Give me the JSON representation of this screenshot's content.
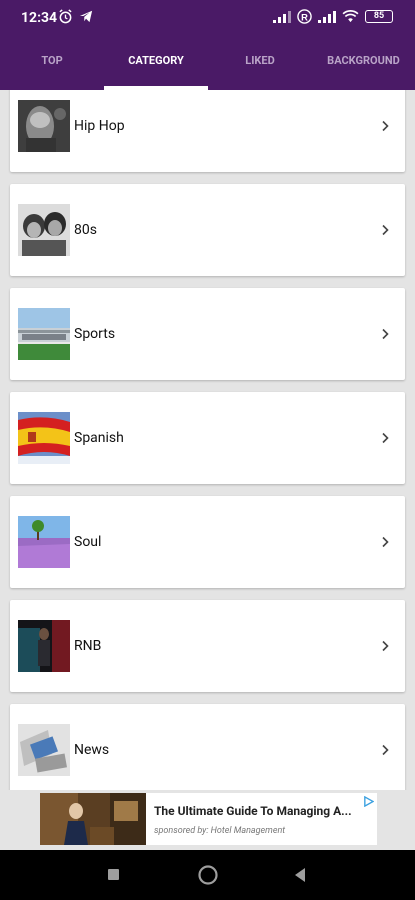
{
  "status": {
    "time": "12:34",
    "battery": "85"
  },
  "tabs": [
    {
      "label": "TOP"
    },
    {
      "label": "CATEGORY"
    },
    {
      "label": "LIKED"
    },
    {
      "label": "BACKGROUND"
    }
  ],
  "active_tab": "CATEGORY",
  "categories": [
    {
      "label": "Hip Hop"
    },
    {
      "label": "80s"
    },
    {
      "label": "Sports"
    },
    {
      "label": "Spanish"
    },
    {
      "label": "Soul"
    },
    {
      "label": "RNB"
    },
    {
      "label": "News"
    }
  ],
  "ad": {
    "title": "The Ultimate Guide To Managing A...",
    "subtitle": "sponsored by: Hotel Management"
  },
  "colors": {
    "primary": "#4a1a66",
    "tab_inactive": "#b9a3c7",
    "background": "#e4e4e4"
  }
}
